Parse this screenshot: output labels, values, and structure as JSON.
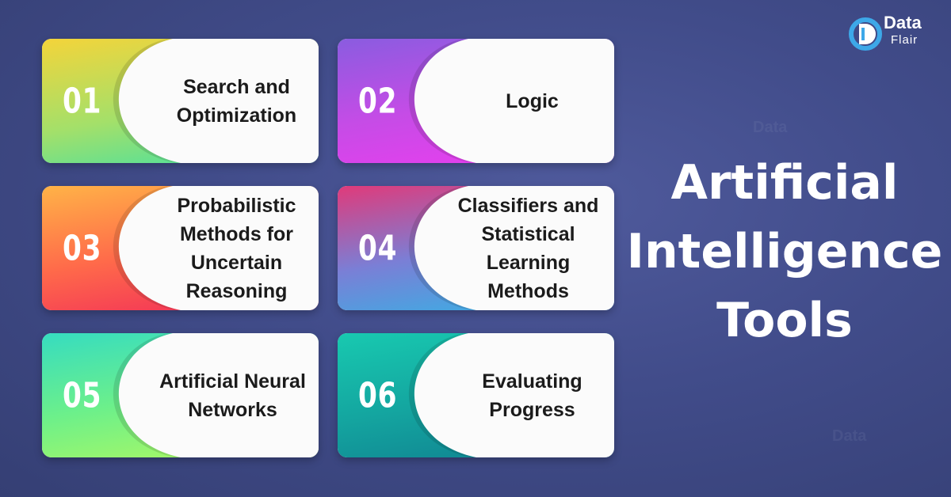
{
  "brand": {
    "name_line1": "Data",
    "name_line2": "Flair"
  },
  "title": {
    "line1": "Artificial",
    "line2": "Intelligence",
    "line3": "Tools"
  },
  "cards": [
    {
      "number": "01",
      "lines": [
        "Search and",
        "Optimization"
      ],
      "gradient": [
        "#f4d43a",
        "#a3e06a",
        "#3fe1a6"
      ]
    },
    {
      "number": "02",
      "lines": [
        "Logic"
      ],
      "gradient": [
        "#8a5ce0",
        "#c54ce6",
        "#ee3cf0"
      ]
    },
    {
      "number": "03",
      "lines": [
        "Probabilistic",
        "Methods for",
        "Uncertain",
        "Reasoning"
      ],
      "gradient": [
        "#ffb347",
        "#ff6a4a",
        "#f0285a"
      ]
    },
    {
      "number": "04",
      "lines": [
        "Classifiers and",
        "Statistical",
        "Learning",
        "Methods"
      ],
      "gradient": [
        "#e03a7a",
        "#7a7fd6",
        "#2fb7e6"
      ]
    },
    {
      "number": "05",
      "lines": [
        "Artificial Neural",
        "Networks"
      ],
      "gradient": [
        "#36dcc0",
        "#6df08a",
        "#b4f95e"
      ]
    },
    {
      "number": "06",
      "lines": [
        "Evaluating",
        "Progress"
      ],
      "gradient": [
        "#18c9b0",
        "#14a6a0",
        "#0f7f8f"
      ]
    }
  ],
  "colors": {
    "background": "#414c8a",
    "card_text": "#1b1b1b",
    "title_text": "#ffffff"
  }
}
